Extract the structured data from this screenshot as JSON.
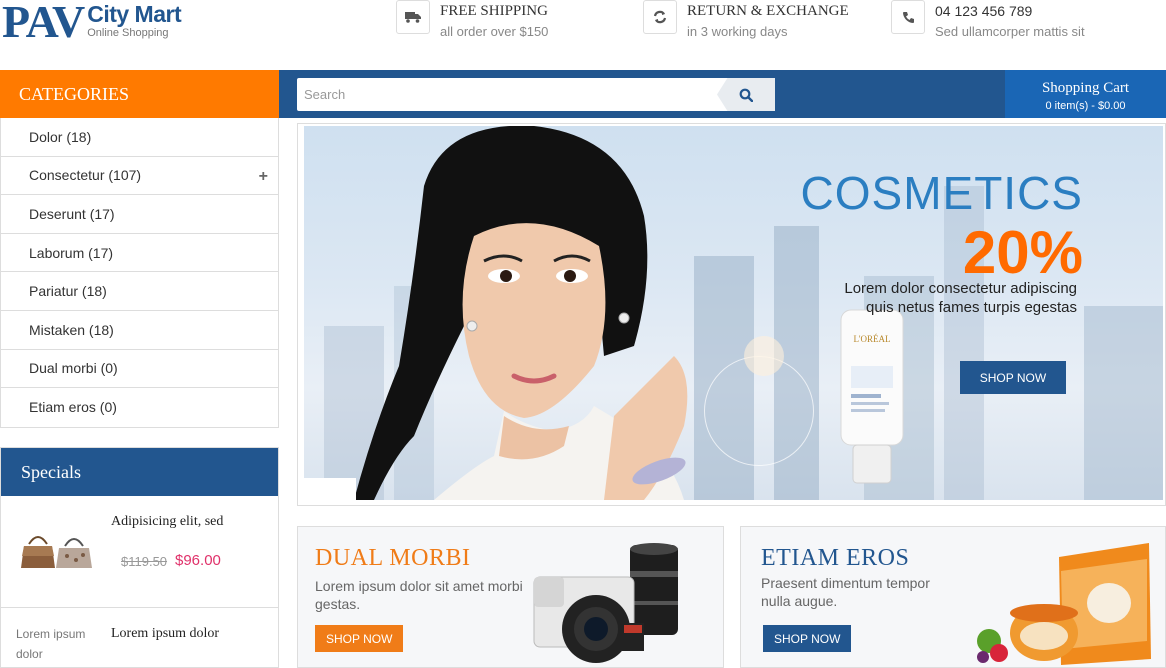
{
  "logo": {
    "pav": "PAV",
    "city": "City Mart",
    "tagline": "Online Shopping"
  },
  "features": [
    {
      "icon": "truck-icon",
      "title": "FREE SHIPPING",
      "sub": "all order over $150"
    },
    {
      "icon": "refresh-icon",
      "title": "RETURN & EXCHANGE",
      "sub": "in 3 working days"
    },
    {
      "icon": "phone-icon",
      "title": "04 123 456 789",
      "sub": "Sed ullamcorper mattis sit"
    }
  ],
  "categories": {
    "title": "CATEGORIES",
    "items": [
      {
        "label": "Dolor (18)"
      },
      {
        "label": "Consectetur (107)",
        "expand": "+"
      },
      {
        "label": "Deserunt (17)"
      },
      {
        "label": "Laborum (17)"
      },
      {
        "label": "Pariatur (18)"
      },
      {
        "label": "Mistaken (18)"
      },
      {
        "label": "Dual morbi (0)"
      },
      {
        "label": "Etiam eros (0)"
      }
    ]
  },
  "search": {
    "placeholder": "Search"
  },
  "cart": {
    "title": "Shopping Cart",
    "summary": "0 item(s) - $0.00"
  },
  "specials": {
    "title": "Specials",
    "items": [
      {
        "title": "Adipisicing elit, sed",
        "old_price": "$119.50",
        "price": "$96.00"
      },
      {
        "left_text": "Lorem ipsum dolor",
        "title": "Lorem ipsum dolor"
      }
    ]
  },
  "banner": {
    "title": "COSMETICS",
    "discount": "20%",
    "text": "Lorem dolor consectetur adipiscing quis netus fames turpis egestas",
    "button": "SHOP NOW",
    "product_brand": "L'ORÉAL"
  },
  "promos": [
    {
      "title": "DUAL MORBI",
      "text": "Lorem ipsum dolor sit amet morbi gestas.",
      "button": "SHOP NOW",
      "color": "#f07c18"
    },
    {
      "title": "ETIAM EROS",
      "text": "Praesent dimentum tempor nulla augue.",
      "button": "SHOP NOW",
      "color": "#22568f"
    }
  ],
  "colors": {
    "brand_blue": "#22568f",
    "accent_orange": "#ff7a00",
    "cart_blue": "#1a66b5",
    "price_pink": "#e0316a"
  }
}
